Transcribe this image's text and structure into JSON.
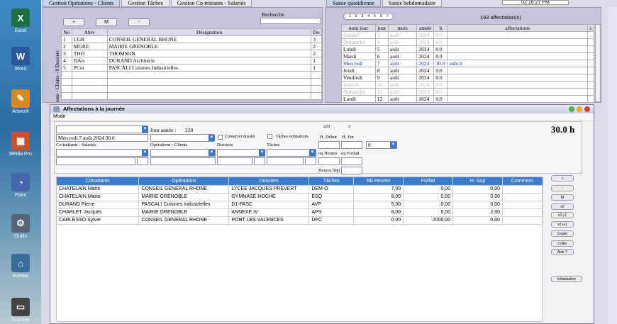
{
  "desktop": [
    {
      "name": "excel-icon",
      "label": "Excel",
      "color": "#1d7044",
      "glyph": "X"
    },
    {
      "name": "word-icon",
      "label": "Word",
      "color": "#2b5797",
      "glyph": "W"
    },
    {
      "name": "artwork-icon",
      "label": "Artwork",
      "color": "#d88a1e",
      "glyph": "✎"
    },
    {
      "name": "media-icon",
      "label": "Média Pro",
      "color": "#c8502a",
      "glyph": "▦"
    },
    {
      "name": "paint-icon",
      "label": "Paint",
      "color": "#4466aa",
      "glyph": "◔"
    },
    {
      "name": "tools-icon",
      "label": "Outils",
      "color": "#556677",
      "glyph": "⚙"
    },
    {
      "name": "desktop-icon",
      "label": "Bureau",
      "color": "#3a6e9a",
      "glyph": "⌂"
    },
    {
      "name": "scanner-icon",
      "label": "Scanner",
      "color": "#444",
      "glyph": "▭"
    }
  ],
  "tabs_left": [
    "Gestion Opérations - Clients",
    "Gestion Tâches",
    "Gestion Co-traitants - Salariés"
  ],
  "tabs_right": [
    "Saisie quotidienne",
    "Saisie hebdomadaire"
  ],
  "clock": "02:16:27 PM",
  "left_panel": {
    "buttons": [
      "+",
      "M",
      "-"
    ],
    "search_label": "Recherche",
    "side_text": "onte - Clients - 9 Dossiers",
    "headers": [
      "No",
      "Abrv",
      "Désignation",
      "Do"
    ],
    "rows": [
      [
        "1",
        "CGR",
        "CONSEIL GENERAL RHONE",
        "3"
      ],
      [
        "2",
        "MGRE",
        "MAIRIE GRENOBLE",
        "2"
      ],
      [
        "3",
        "THO",
        "THOMSON",
        "2"
      ],
      [
        "4",
        "DArc",
        "DURAND Architecte",
        "1"
      ],
      [
        "5",
        "PCui",
        "PASCALI Cuisines Industrielles",
        "1"
      ]
    ]
  },
  "right_panel": {
    "pages": [
      "1",
      "2",
      "3",
      "4",
      "5",
      "6",
      "7"
    ],
    "count": "193 affectation(s)",
    "headers": [
      "nom jour",
      "jour",
      "mois",
      "année",
      "h",
      "affectations",
      "c"
    ],
    "rows": [
      {
        "c": [
          "Samedi",
          "3",
          "août",
          "2024",
          "0.0",
          ""
        ],
        "s": "g"
      },
      {
        "c": [
          "Dimanche",
          "4",
          "août",
          "2024",
          "0.0",
          ""
        ],
        "s": "g"
      },
      {
        "c": [
          "Lundi",
          "5",
          "août",
          "2024",
          "0.0",
          ""
        ],
        "s": ""
      },
      {
        "c": [
          "Mardi",
          "6",
          "août",
          "2024",
          "0.0",
          ""
        ],
        "s": ""
      },
      {
        "c": [
          "Mercredi",
          "7",
          "août",
          "2024",
          "30.0",
          "aubcd"
        ],
        "s": "b"
      },
      {
        "c": [
          "Jeudi",
          "8",
          "août",
          "2024",
          "0.0",
          ""
        ],
        "s": ""
      },
      {
        "c": [
          "Vendredi",
          "9",
          "août",
          "2024",
          "0.0",
          ""
        ],
        "s": ""
      },
      {
        "c": [
          "Samedi",
          "10",
          "août",
          "2024",
          "0.0",
          ""
        ],
        "s": "g"
      },
      {
        "c": [
          "Dimanche",
          "11",
          "août",
          "2024",
          "0.0",
          ""
        ],
        "s": "g"
      },
      {
        "c": [
          "Lundi",
          "12",
          "août",
          "2024",
          "0.0",
          ""
        ],
        "s": ""
      }
    ]
  },
  "dialog": {
    "title": "Affectations à la journée",
    "menu": "Mode",
    "jour_annee_label": "Jour année :",
    "jour_annee_value": "220",
    "top_n1": "220",
    "top_n2": "3",
    "date_value": "Mercredi 7 août 2024 30.0",
    "conserver": "Conserver dossier",
    "taches_estim": "Tâches estimations",
    "h_debut": "H. Début",
    "h_fin": "H. Fin",
    "fin_value": "0",
    "total": "30.0 h",
    "co_label": "Co-traitants - Salariés",
    "op_label": "Opérations - Clients",
    "dos_label": "Dossiers",
    "tach_label": "Tâches",
    "ou_heures": "ou Heures",
    "ou_forfait": "ou Forfait",
    "heures_sup": "Heures Sup",
    "grid_headers": [
      "Cotraitants",
      "Opérations",
      "Dossiers",
      "Tâches",
      "Nb Heures",
      "Forfait",
      "H. Sup",
      "Comment."
    ],
    "grid_rows": [
      [
        "CHATELAIN Marie",
        "CONSEIL GENERAL RHONE",
        "LYCEE JACQUES PREVERT",
        "DEM-O",
        "7,00",
        "0,00",
        "0,00",
        ""
      ],
      [
        "CHATELAIN Marie",
        "MAIRIE GRENOBLE",
        "GYMNASE HOCHE",
        "ESQ",
        "8,00",
        "0,00",
        "0,00",
        ""
      ],
      [
        "DURAND Pierre",
        "PASCALI Cuisines Industrielles",
        "D1-PASC",
        "AVP",
        "5,00",
        "0,00",
        "0,00",
        ""
      ],
      [
        "CHARLET Jacques",
        "MAIRIE GRENOBLE",
        "ANNEXE IV",
        "APS",
        "8,00",
        "0,00",
        "2,00",
        ""
      ],
      [
        "CARLESSO Sylvie",
        "CONSEIL GENERAL RHONE",
        "PONT LES VALENCES",
        "DPC",
        "0,00",
        "2000,00",
        "0,00",
        ""
      ]
    ],
    "side_buttons": [
      "+",
      "-",
      "M",
      "x2",
      "x2 j-1",
      "x2 j+1",
      "Copier",
      "Coller",
      "Aide ?"
    ],
    "init_button": "Initialisation"
  }
}
